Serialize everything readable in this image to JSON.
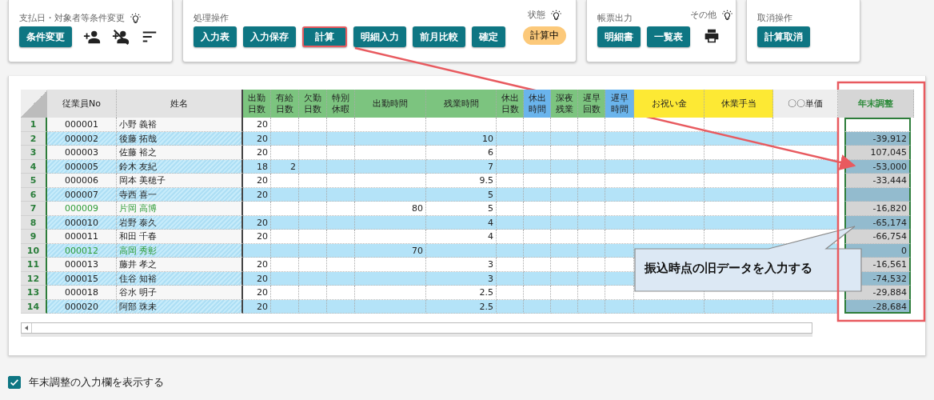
{
  "toolbar": [
    {
      "label": "支払日・対象者等条件変更",
      "buttons": [
        {
          "label": "条件変更",
          "annotated": false
        }
      ]
    },
    {
      "label": "処理操作",
      "buttons": [
        {
          "label": "入力表",
          "annotated": false
        },
        {
          "label": "入力保存",
          "annotated": false
        },
        {
          "label": "計算",
          "annotated": true
        },
        {
          "label": "明細入力",
          "annotated": false
        },
        {
          "label": "前月比較",
          "annotated": false
        },
        {
          "label": "確定",
          "annotated": false
        }
      ],
      "side_label": "状態",
      "status": "計算中"
    },
    {
      "label": "帳票出力",
      "buttons": [
        {
          "label": "明細書",
          "annotated": false
        },
        {
          "label": "一覧表",
          "annotated": false
        }
      ],
      "side_label": "その他"
    },
    {
      "label": "取消操作",
      "buttons": [
        {
          "label": "計算取消",
          "annotated": false
        }
      ]
    }
  ],
  "table": {
    "columns": [
      {
        "label": "従業員No",
        "color": "#e3e3e3",
        "selected": false
      },
      {
        "label": "姓名",
        "color": "#e3e3e3",
        "selected": false
      },
      {
        "label": "出勤日数",
        "color": "#7cc47f",
        "selected": false
      },
      {
        "label": "有給日数",
        "color": "#7cc47f",
        "selected": false
      },
      {
        "label": "欠勤日数",
        "color": "#7cc47f",
        "selected": false
      },
      {
        "label": "特別休暇",
        "color": "#7cc47f",
        "selected": false
      },
      {
        "label": "出勤時間",
        "color": "#7cc47f",
        "selected": false
      },
      {
        "label": "残業時間",
        "color": "#7cc47f",
        "selected": false
      },
      {
        "label": "休出日数",
        "color": "#7cc47f",
        "selected": false
      },
      {
        "label": "休出時間",
        "color": "#6ab4ec",
        "selected": false
      },
      {
        "label": "深夜残業",
        "color": "#7cc47f",
        "selected": false
      },
      {
        "label": "遅早回数",
        "color": "#7cc47f",
        "selected": false
      },
      {
        "label": "遅早時間",
        "color": "#6ab4ec",
        "selected": false
      },
      {
        "label": "お祝い金",
        "color": "#fde934",
        "selected": false
      },
      {
        "label": "休業手当",
        "color": "#fde934",
        "selected": false
      },
      {
        "label": "〇〇単価",
        "color": "#eeeeee",
        "selected": false
      },
      {
        "label": "年末調整",
        "color": "#d6d6d6",
        "selected": true
      }
    ],
    "rows": [
      {
        "index": "1",
        "flagged": false,
        "cells": [
          "000001",
          "小野 義裕",
          "20",
          "",
          "",
          "",
          "",
          "",
          "",
          "",
          "",
          "",
          "",
          "",
          "",
          "",
          ""
        ]
      },
      {
        "index": "2",
        "flagged": false,
        "cells": [
          "000002",
          "後藤 拓哉",
          "20",
          "",
          "",
          "",
          "",
          "10",
          "",
          "",
          "",
          "",
          "",
          "",
          "",
          "",
          "-39,912"
        ]
      },
      {
        "index": "3",
        "flagged": false,
        "cells": [
          "000003",
          "佐藤 裕之",
          "20",
          "",
          "",
          "",
          "",
          "6",
          "",
          "",
          "",
          "",
          "",
          "",
          "",
          "",
          "107,045"
        ]
      },
      {
        "index": "4",
        "flagged": false,
        "cells": [
          "000005",
          "鈴木 友紀",
          "18",
          "2",
          "",
          "",
          "",
          "7",
          "",
          "",
          "",
          "",
          "",
          "",
          "",
          "",
          "-53,000"
        ]
      },
      {
        "index": "5",
        "flagged": false,
        "cells": [
          "000006",
          "岡本 美穂子",
          "20",
          "",
          "",
          "",
          "",
          "9.5",
          "",
          "",
          "",
          "",
          "",
          "",
          "",
          "",
          "-33,444"
        ]
      },
      {
        "index": "6",
        "flagged": false,
        "cells": [
          "000007",
          "寺西 喜一",
          "20",
          "",
          "",
          "",
          "",
          "5",
          "",
          "",
          "",
          "",
          "",
          "",
          "",
          "",
          ""
        ]
      },
      {
        "index": "7",
        "flagged": true,
        "cells": [
          "000009",
          "片岡 高博",
          "",
          "",
          "",
          "",
          "80",
          "5",
          "",
          "",
          "",
          "",
          "",
          "",
          "",
          "",
          "-16,820"
        ]
      },
      {
        "index": "8",
        "flagged": false,
        "cells": [
          "000010",
          "岩野 泰久",
          "20",
          "",
          "",
          "",
          "",
          "4",
          "",
          "",
          "",
          "",
          "",
          "",
          "",
          "",
          "-65,174"
        ]
      },
      {
        "index": "9",
        "flagged": false,
        "cells": [
          "000011",
          "和田 千春",
          "20",
          "",
          "",
          "",
          "",
          "4",
          "",
          "",
          "",
          "",
          "",
          "",
          "",
          "",
          "-66,754"
        ]
      },
      {
        "index": "10",
        "flagged": true,
        "cells": [
          "000012",
          "高岡 秀彰",
          "",
          "",
          "",
          "",
          "70",
          "",
          "",
          "",
          "",
          "",
          "",
          "",
          "",
          "",
          "0"
        ]
      },
      {
        "index": "11",
        "flagged": false,
        "cells": [
          "000013",
          "藤井 孝之",
          "20",
          "",
          "",
          "",
          "",
          "3",
          "",
          "",
          "",
          "",
          "",
          "",
          "",
          "",
          "-16,561"
        ]
      },
      {
        "index": "12",
        "flagged": false,
        "cells": [
          "000015",
          "住谷 知裕",
          "20",
          "",
          "",
          "",
          "",
          "3",
          "",
          "",
          "",
          "",
          "",
          "",
          "",
          "",
          "-74,532"
        ]
      },
      {
        "index": "13",
        "flagged": false,
        "cells": [
          "000018",
          "谷水 明子",
          "20",
          "",
          "",
          "",
          "",
          "2.5",
          "",
          "",
          "",
          "",
          "",
          "",
          "",
          "",
          "-29,884"
        ]
      },
      {
        "index": "14",
        "flagged": false,
        "cells": [
          "000020",
          "阿部 珠未",
          "20",
          "",
          "",
          "",
          "",
          "2.5",
          "",
          "",
          "",
          "",
          "",
          "",
          "",
          "",
          "-28,684"
        ]
      }
    ]
  },
  "callout": "振込時点の旧データを入力する",
  "option": {
    "label": "年末調整の入力欄を表示する",
    "checked": true
  }
}
